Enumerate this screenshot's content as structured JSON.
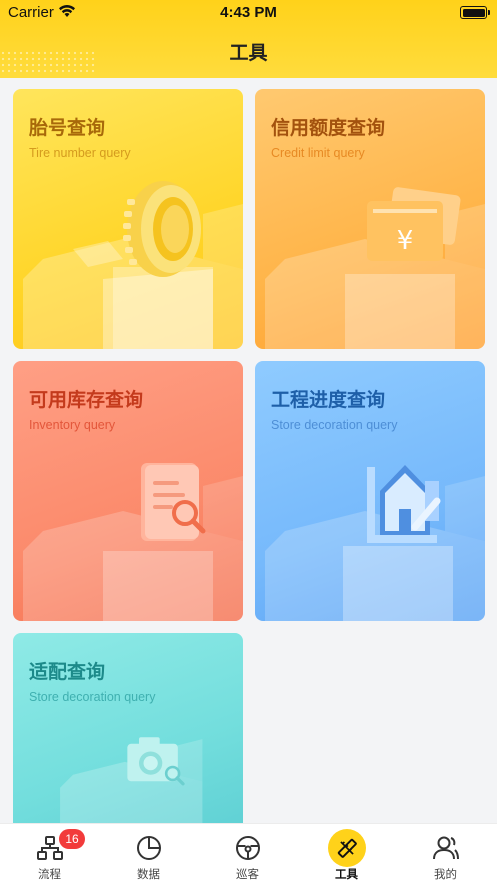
{
  "status_bar": {
    "carrier": "Carrier",
    "time": "4:43 PM"
  },
  "header": {
    "title": "工具"
  },
  "cards": [
    {
      "title": "胎号查询",
      "subtitle": "Tire number query",
      "icon": "tire-icon"
    },
    {
      "title": "信用额度查询",
      "subtitle": "Credit limit query",
      "icon": "credit-card-yen-icon"
    },
    {
      "title": "可用库存查询",
      "subtitle": "Inventory query",
      "icon": "document-search-icon"
    },
    {
      "title": "工程进度查询",
      "subtitle": "Store decoration query",
      "icon": "house-ruler-icon"
    },
    {
      "title": "适配查询",
      "subtitle": "Store decoration query",
      "icon": "camera-search-icon"
    }
  ],
  "tabbar": {
    "items": [
      {
        "label": "流程",
        "icon": "flow-icon",
        "badge": "16"
      },
      {
        "label": "数据",
        "icon": "pie-chart-icon"
      },
      {
        "label": "巡客",
        "icon": "steering-wheel-icon"
      },
      {
        "label": "工具",
        "icon": "ruler-pencil-icon",
        "active": true
      },
      {
        "label": "我的",
        "icon": "user-icon"
      }
    ]
  },
  "colors": {
    "header": "#ffd21a",
    "active_tab": "#ffd21a",
    "badge": "#f23b3b"
  }
}
